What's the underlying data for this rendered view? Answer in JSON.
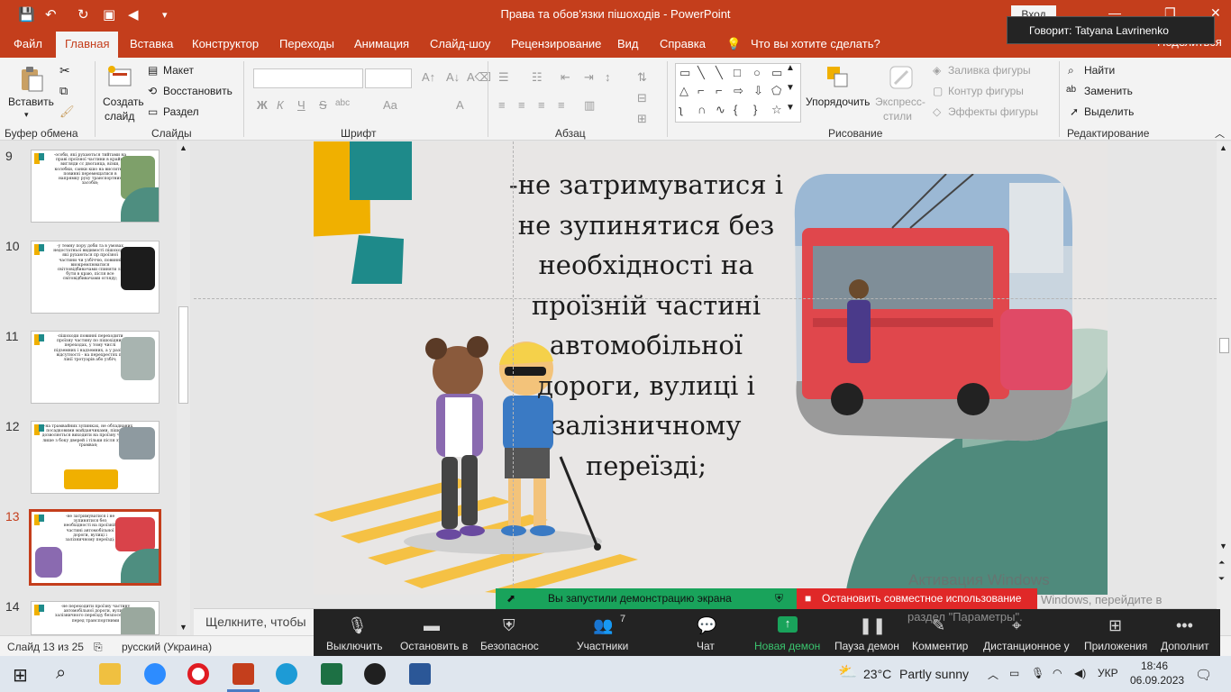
{
  "window": {
    "title": "Права та обов'язки пішоходів  -  PowerPoint",
    "login": "Вход",
    "speaker_tooltip": "Говорит: Tatyana Lavrinenko"
  },
  "tabs": [
    "Файл",
    "Главная",
    "Вставка",
    "Конструктор",
    "Переходы",
    "Анимация",
    "Слайд-шоу",
    "Рецензирование",
    "Вид",
    "Справка",
    "Что вы хотите сделать?"
  ],
  "share_label": "Поделиться",
  "ribbon": {
    "clipboard": {
      "paste": "Вставить",
      "label": "Буфер обмена"
    },
    "slides": {
      "new_slide": "Создать",
      "new_slide2": "слайд",
      "layout": "Макет",
      "reset": "Восстановить",
      "section": "Раздел",
      "label": "Слайды"
    },
    "font": {
      "label": "Шрифт",
      "bold": "Ж",
      "italic": "К",
      "underline": "Ч",
      "strike": "S",
      "spacing": "abc",
      "case": "Aa",
      "color": "A"
    },
    "paragraph": {
      "label": "Абзац"
    },
    "drawing": {
      "arrange": "Упорядочить",
      "quick_styles": "Экспресс-",
      "quick_styles2": "стили",
      "fill": "Заливка фигуры",
      "outline": "Контур фигуры",
      "effects": "Эффекты фигуры",
      "label": "Рисование"
    },
    "editing": {
      "find": "Найти",
      "replace": "Заменить",
      "select": "Выделить",
      "label": "Редактирование"
    }
  },
  "thumbnails": [
    {
      "num": "9",
      "text": "-особи, які рухаються тийтами на праві проїзної частини в крайні вигляди сс двоганца, візки, колобки, санки кшо на висситку, повинні перемещатися в напрямку руху транспортних засобів;"
    },
    {
      "num": "10",
      "text": "-у темну пору доби та в умовах недостатньої видимості пішоходи, які рухаються пр проїзної частини чи узбіччю, повинні виокремлюватися світловідбивачами спиняти ля бути в краю, після все світовідбивачами огляду;"
    },
    {
      "num": "11",
      "text": "-пішоходи повинні переходити проїзну частину по пішохідних переходах, у тому числі підземних і надземних, а у разі їх відсутності - на перехрестях по лінії тротуарів або узбіч;"
    },
    {
      "num": "12",
      "text": "-на трамвайних зупинках, не обладнаних посадковими майданчиками, пішоходи дозволяється виходити на проїзну частину лише з боку дверей і тільки після зупинки трамвая;"
    },
    {
      "num": "13",
      "text": "-не затримуватися і не зупинятися без необхідності на проїзній частині автомобільної дороги, вулиці і залізничному переїзді;",
      "selected": true
    },
    {
      "num": "14",
      "text": "-не переходити проїзну частину автомобільної дороги, вулиці, залізничного переїзду безпосередньо перед транспортними"
    }
  ],
  "slide": {
    "text": "-не затримуватися і не зупинятися без необхідності на проїзній частині автомобільної дороги, вулиці і залізничному переїзді;",
    "notes_placeholder": "Щелкните, чтобы"
  },
  "zoom": {
    "share_notice": "Вы запустили демонстрацию экрана",
    "stop_share": "Остановить совместное использование",
    "participants_count": "7",
    "buttons": [
      "Выключить",
      "Остановить в",
      "Безопаснос",
      "Участники",
      "Чат",
      "Новая демон",
      "Пауза демон",
      "Комментир",
      "Дистанционное у",
      "Приложения",
      "Дополнит"
    ]
  },
  "watermark": {
    "line1": "Активация Windows",
    "line2": "Windows, перейдите в",
    "line3": "раздел \"Параметры\"."
  },
  "statusbar": {
    "slide_pos": "Слайд 13 из 25",
    "language": "русский (Украина)"
  },
  "taskbar": {
    "weather_temp": "23°C",
    "weather_text": "Partly sunny",
    "lang": "УКР",
    "time": "18:46",
    "date": "06.09.2023"
  }
}
